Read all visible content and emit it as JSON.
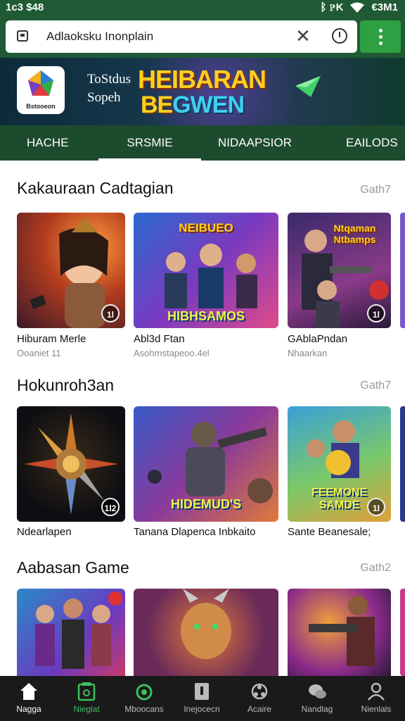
{
  "status_bar": {
    "time": "1c3 $48",
    "indicators": "ᛒ ℙK",
    "battery_text": "€3M1"
  },
  "browser": {
    "url_text": "Adlaoksku Inonplain",
    "close_icon": "close-icon",
    "reload_icon": "reload-icon",
    "menu_icon": "kebab-menu-icon"
  },
  "banner": {
    "logo_caption": "Bstooeon",
    "small_line1": "ToStdus",
    "small_line2": "Sopeh",
    "big_line1": "HEIBARAN",
    "big_line2_a": "BE",
    "big_line2_b": "GWEN"
  },
  "tabs": [
    {
      "label": "HACHE"
    },
    {
      "label": "SRSMIE"
    },
    {
      "label": "NIDAAPSIOR"
    },
    {
      "label": "EAILODS"
    }
  ],
  "sections": [
    {
      "title": "Kakauraan Cadtagian",
      "link": "Gath7",
      "cards": [
        {
          "label": "Hiburam Merle",
          "sub": "Ooaniet 11",
          "badge": "1l",
          "art_title": "",
          "art_bottom": ""
        },
        {
          "label": "Abl3d Ftan",
          "sub": "Asohmstapeoo.4el",
          "badge": "",
          "art_title": "NEIBUEO",
          "art_bottom": "HIBHSAMOS"
        },
        {
          "label": "GAblaPndan",
          "sub": "Nhaarkan",
          "badge": "1l",
          "art_title": "Ntqaman Ntbamps",
          "art_bottom": ""
        }
      ]
    },
    {
      "title": "Hokunroh3an",
      "link": "Gath7",
      "cards": [
        {
          "label": "Ndearlapen",
          "sub": "",
          "badge": "1l2",
          "art_title": "",
          "art_bottom": ""
        },
        {
          "label": "Tanana Dlapenca  Inbkaito",
          "sub": "",
          "badge": "",
          "art_title": "",
          "art_bottom": "HIDEMUD'S"
        },
        {
          "label": "Sante Beanesale;",
          "sub": "",
          "badge": "1l",
          "art_title": "",
          "art_bottom": "FEEMONE SAMDE"
        }
      ]
    },
    {
      "title": "Aabasan Game",
      "link": "Gath2",
      "cards": [
        {
          "label": "",
          "sub": "",
          "badge": "",
          "art_title": "",
          "art_bottom": ""
        },
        {
          "label": "",
          "sub": "",
          "badge": "",
          "art_title": "",
          "art_bottom": ""
        },
        {
          "label": "",
          "sub": "",
          "badge": "",
          "art_title": "",
          "art_bottom": ""
        }
      ]
    }
  ],
  "bottom_nav": [
    {
      "label": "Nagga",
      "icon": "home-icon"
    },
    {
      "label": "Nieglat",
      "icon": "calendar-icon"
    },
    {
      "label": "Mboocans",
      "icon": "power-icon"
    },
    {
      "label": "Inejocecn",
      "icon": "info-icon"
    },
    {
      "label": "Acaire",
      "icon": "network-icon"
    },
    {
      "label": "Nandlag",
      "icon": "chat-icon"
    },
    {
      "label": "Nienlals",
      "icon": "user-icon"
    }
  ]
}
